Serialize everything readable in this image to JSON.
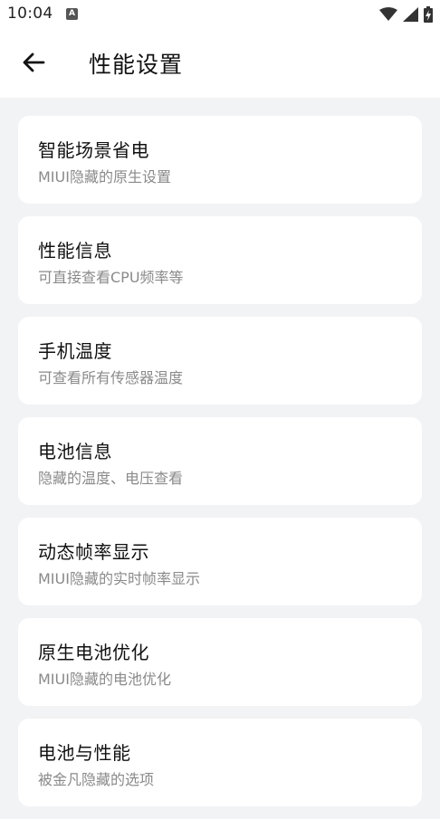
{
  "status_bar": {
    "time": "10:04",
    "notification_badge": "A",
    "icons": [
      "wifi-icon",
      "signal-icon",
      "battery-charging-icon"
    ]
  },
  "header": {
    "title": "性能设置",
    "back_icon": "arrow-left-icon"
  },
  "items": [
    {
      "title": "智能场景省电",
      "subtitle": "MIUI隐藏的原生设置"
    },
    {
      "title": "性能信息",
      "subtitle": "可直接查看CPU频率等"
    },
    {
      "title": "手机温度",
      "subtitle": "可查看所有传感器温度"
    },
    {
      "title": "电池信息",
      "subtitle": "隐藏的温度、电压查看"
    },
    {
      "title": "动态帧率显示",
      "subtitle": "MIUI隐藏的实时帧率显示"
    },
    {
      "title": "原生电池优化",
      "subtitle": "MIUI隐藏的电池优化"
    },
    {
      "title": "电池与性能",
      "subtitle": "被金凡隐藏的选项"
    }
  ],
  "colors": {
    "background": "#f2f3f5",
    "card": "#ffffff",
    "title_text": "#111111",
    "subtitle_text": "#8a8a8a"
  }
}
